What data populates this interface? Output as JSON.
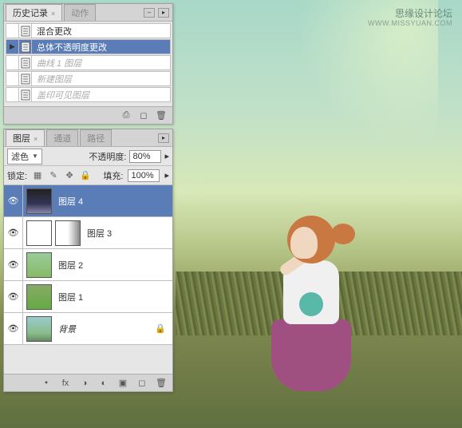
{
  "watermark": {
    "main": "思缘设计论坛",
    "sub": "WWW.MISSYUAN.COM"
  },
  "history": {
    "tabs": {
      "history": "历史记录",
      "actions": "动作"
    },
    "items": [
      {
        "label": "混合更改",
        "selected": false,
        "disabled": false,
        "hasPlay": false
      },
      {
        "label": "总体不透明度更改",
        "selected": true,
        "disabled": false,
        "hasPlay": true
      },
      {
        "label": "曲线 1 图层",
        "selected": false,
        "disabled": true,
        "hasPlay": false
      },
      {
        "label": "新建图层",
        "selected": false,
        "disabled": true,
        "hasPlay": false
      },
      {
        "label": "盖印可见图层",
        "selected": false,
        "disabled": true,
        "hasPlay": false
      }
    ]
  },
  "layers": {
    "tabs": {
      "layers": "图层",
      "channels": "通道",
      "paths": "路径"
    },
    "blendMode": "滤色",
    "opacityLabel": "不透明度:",
    "opacityValue": "80%",
    "lockLabel": "锁定:",
    "fillLabel": "填充:",
    "fillValue": "100%",
    "items": [
      {
        "label": "图层 4",
        "selected": true,
        "thumbClass": "t4",
        "hasMask": false,
        "locked": false,
        "italic": false
      },
      {
        "label": "图层 3",
        "selected": false,
        "thumbClass": "t3",
        "hasMask": true,
        "locked": false,
        "italic": false
      },
      {
        "label": "图层 2",
        "selected": false,
        "thumbClass": "t2",
        "hasMask": false,
        "locked": false,
        "italic": false
      },
      {
        "label": "图层 1",
        "selected": false,
        "thumbClass": "t1",
        "hasMask": false,
        "locked": false,
        "italic": false
      },
      {
        "label": "背景",
        "selected": false,
        "thumbClass": "t0",
        "hasMask": false,
        "locked": true,
        "italic": true
      }
    ]
  }
}
